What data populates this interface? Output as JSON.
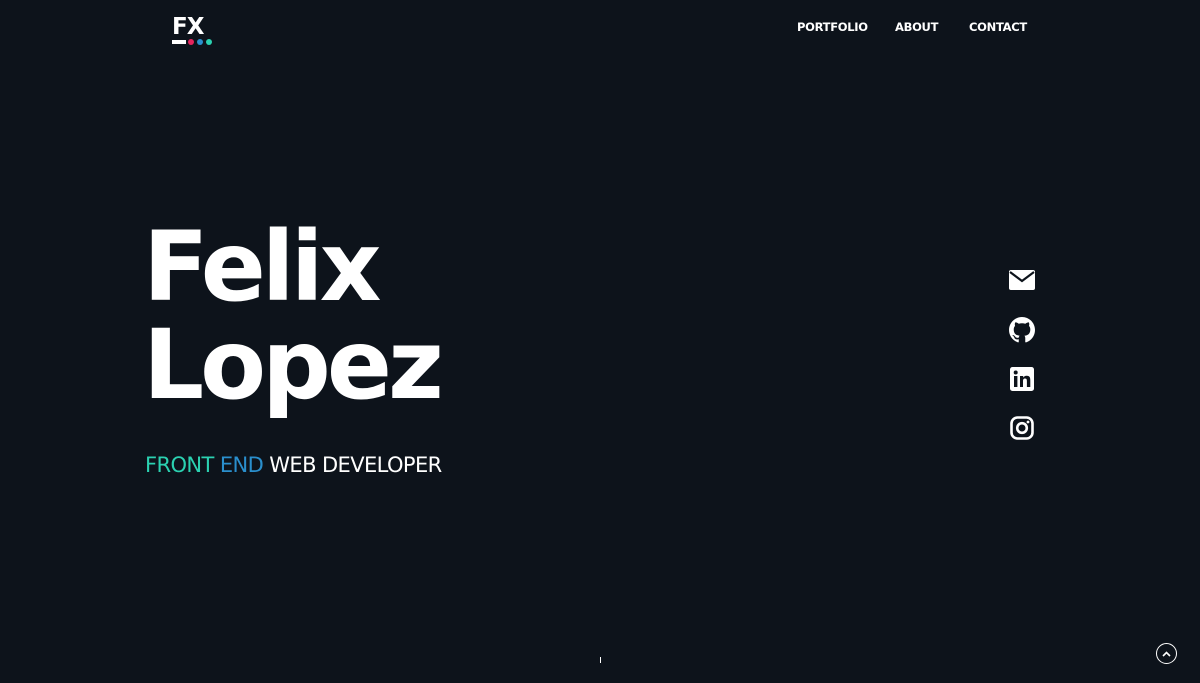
{
  "logo": {
    "text": "FX",
    "dot_colors": [
      "#e6245e",
      "#2a8fcd",
      "#2bd1b1"
    ]
  },
  "nav": {
    "items": [
      {
        "label": "PORTFOLIO"
      },
      {
        "label": "ABOUT"
      },
      {
        "label": "CONTACT"
      }
    ]
  },
  "hero": {
    "first_name": "Felix",
    "last_name": "Lopez",
    "subtitle": {
      "part1": "FRONT",
      "part2": "END",
      "part3": "WEB DEVELOPER"
    }
  },
  "social": {
    "icons": [
      "envelope-icon",
      "github-icon",
      "linkedin-icon",
      "instagram-icon"
    ]
  },
  "colors": {
    "background": "#0d131b",
    "teal": "#2bd1b1",
    "blue": "#2a8fcd",
    "pink": "#e6245e",
    "text": "#ffffff"
  }
}
